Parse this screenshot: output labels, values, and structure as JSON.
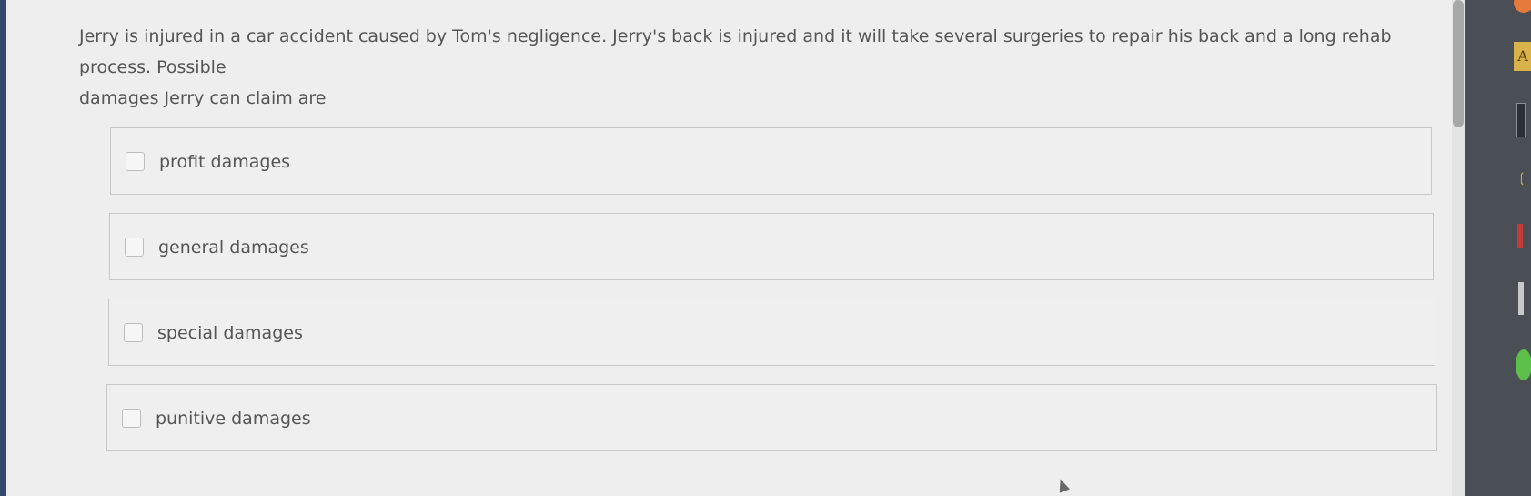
{
  "question": {
    "line1": "Jerry is injured in a car accident caused by Tom's negligence. Jerry's back is injured and it will take several surgeries to repair his back and a long rehab process. Possible",
    "line2": "damages Jerry can claim are"
  },
  "options": [
    {
      "label": "profit damages",
      "checked": false
    },
    {
      "label": "general damages",
      "checked": false
    },
    {
      "label": "special damages",
      "checked": false
    },
    {
      "label": "punitive damages",
      "checked": false
    }
  ],
  "dock": {
    "a_label": "A"
  },
  "colors": {
    "panel_background": "#eeeeee",
    "text": "#555555",
    "option_border": "#c8c8c8",
    "checkbox_border": "#bdbdbd"
  }
}
